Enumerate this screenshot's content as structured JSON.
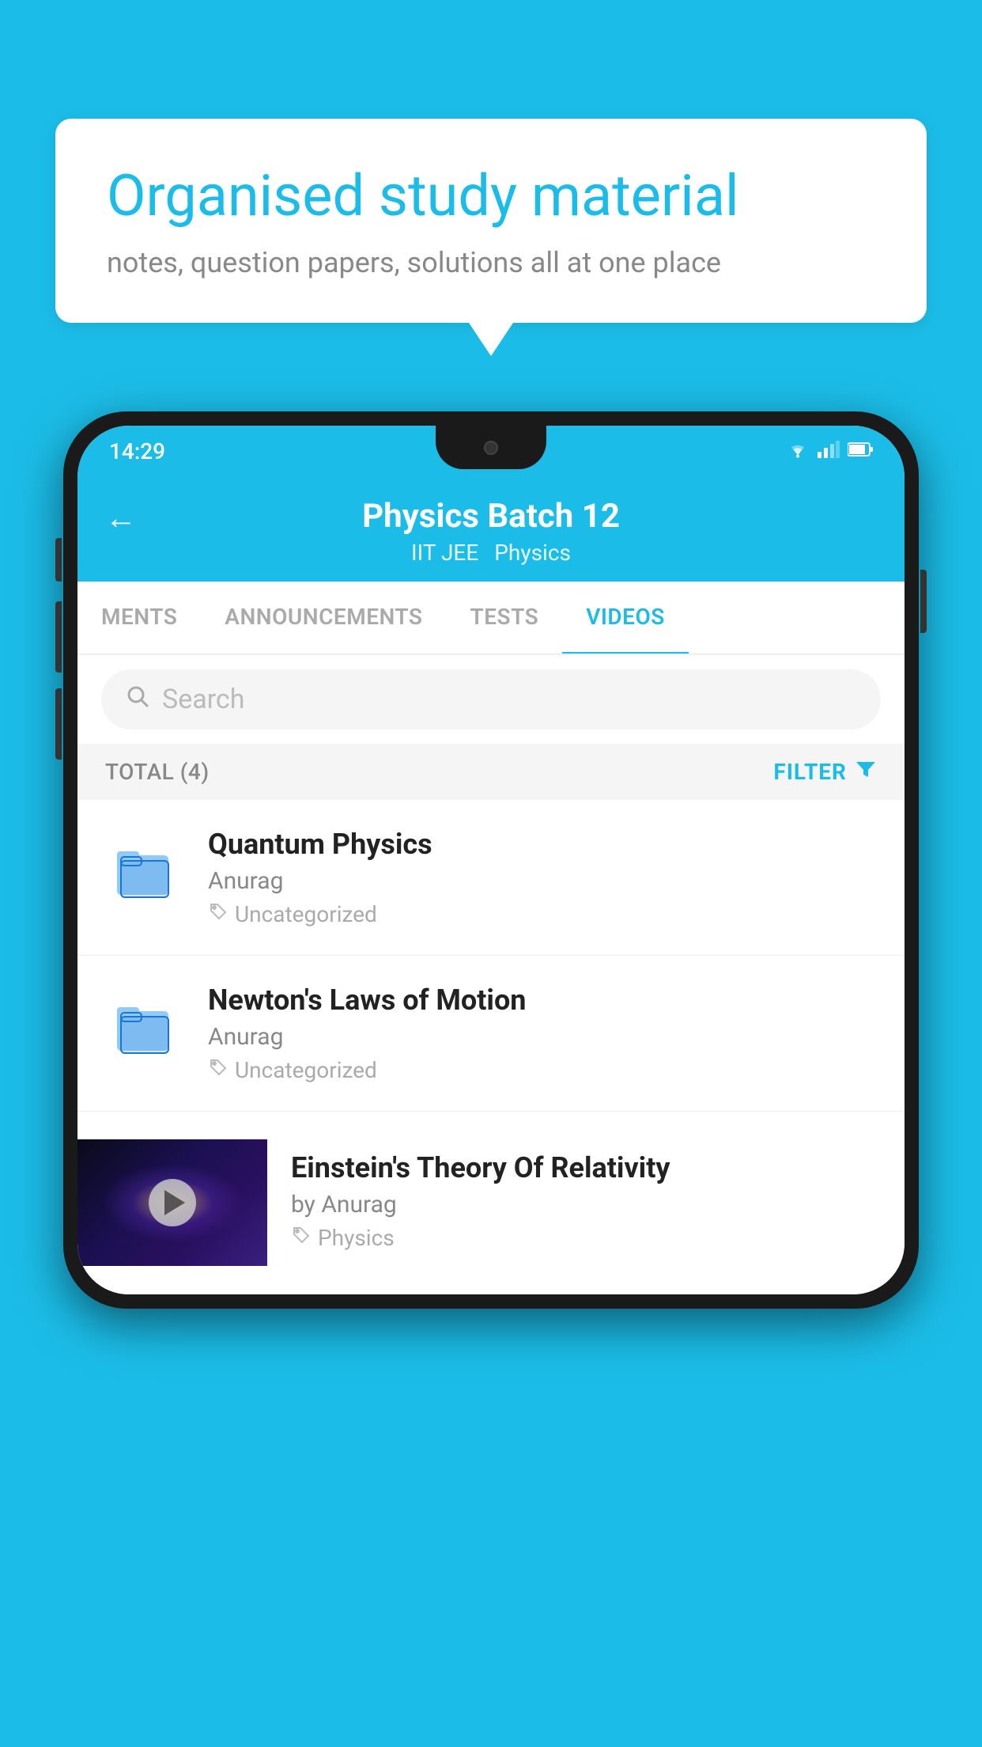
{
  "background_color": "#1BBDE8",
  "speech_bubble": {
    "title": "Organised study material",
    "subtitle": "notes, question papers, solutions all at one place"
  },
  "phone": {
    "status_bar": {
      "time": "14:29",
      "wifi": "▼",
      "signal": "▲",
      "battery": "▮"
    },
    "header": {
      "back_label": "←",
      "title": "Physics Batch 12",
      "subtitle_parts": [
        "IIT JEE",
        "Physics"
      ]
    },
    "tabs": [
      {
        "label": "MENTS",
        "active": false
      },
      {
        "label": "ANNOUNCEMENTS",
        "active": false
      },
      {
        "label": "TESTS",
        "active": false
      },
      {
        "label": "VIDEOS",
        "active": true
      }
    ],
    "search": {
      "placeholder": "Search"
    },
    "filter_bar": {
      "total_label": "TOTAL (4)",
      "filter_label": "FILTER"
    },
    "videos": [
      {
        "id": 1,
        "title": "Quantum Physics",
        "author": "Anurag",
        "tag": "Uncategorized",
        "type": "folder"
      },
      {
        "id": 2,
        "title": "Newton's Laws of Motion",
        "author": "Anurag",
        "tag": "Uncategorized",
        "type": "folder"
      },
      {
        "id": 3,
        "title": "Einstein's Theory Of Relativity",
        "author": "by Anurag",
        "tag": "Physics",
        "type": "video"
      }
    ]
  }
}
